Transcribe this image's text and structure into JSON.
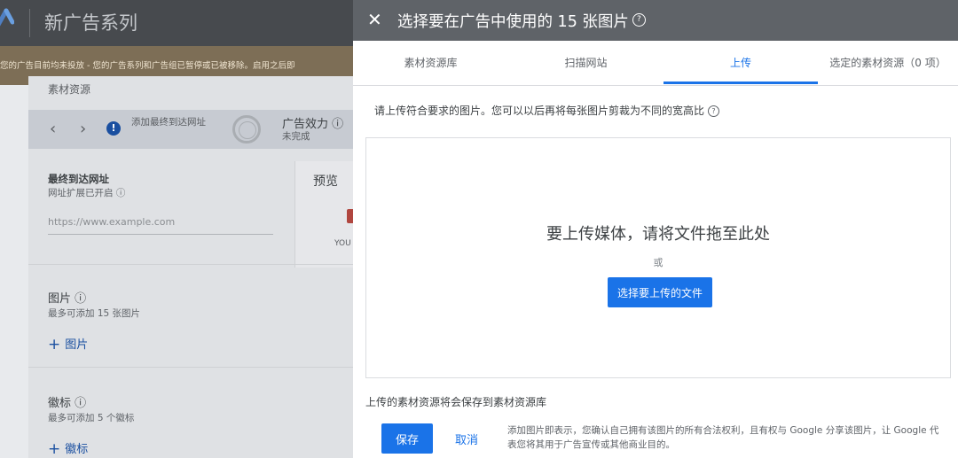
{
  "background": {
    "app_title": "新广告系列",
    "banner_text": "您的广告目前均未投放 - 您的广告系列和广告组已暂停或已被移除。启用之后即",
    "section_title": "素材资源",
    "nav": {
      "add_final_url": "添加最终到达网址",
      "ad_strength_label": "广告效力",
      "ad_strength_value": "未完成"
    },
    "final_url": {
      "label": "最终到达网址",
      "sub": "网址扩展已开启",
      "placeholder": "https://www.example.com"
    },
    "preview": {
      "label": "预览",
      "snippet": "YOU"
    },
    "images": {
      "label": "图片",
      "sub": "最多可添加 15 张图片",
      "add": "图片"
    },
    "logos": {
      "label": "徽标",
      "sub": "最多可添加 5 个徽标",
      "add": "徽标"
    }
  },
  "dialog": {
    "title": "选择要在广告中使用的 15 张图片",
    "tabs": [
      {
        "label": "素材资源库",
        "active": false
      },
      {
        "label": "扫描网站",
        "active": false
      },
      {
        "label": "上传",
        "active": true
      },
      {
        "label": "选定的素材资源（0 项）",
        "active": false
      }
    ],
    "instruction": "请上传符合要求的图片。您可以以后再将每张图片剪裁为不同的宽高比",
    "dropzone": {
      "title": "要上传媒体，请将文件拖至此处",
      "or": "或",
      "choose_button": "选择要上传的文件"
    },
    "saved_note": "上传的素材资源将会保存到素材资源库",
    "save_button": "保存",
    "cancel_button": "取消",
    "legal": "添加图片即表示，您确认自己拥有该图片的所有合法权利，且有权与 Google 分享该图片，让 Google 代表您将其用于广告宣传或其他商业目的。"
  },
  "colors": {
    "accent": "#1a73e8",
    "header": "#5f6368"
  }
}
